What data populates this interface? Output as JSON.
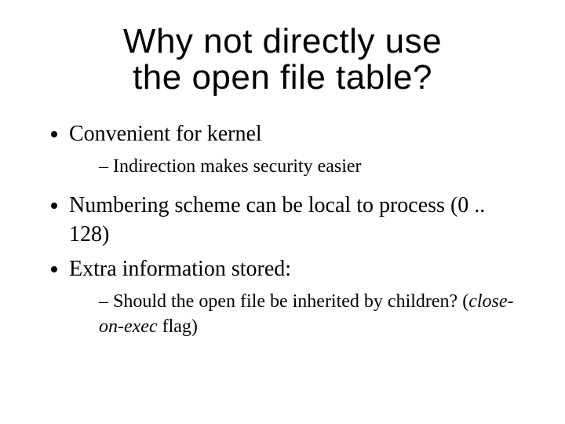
{
  "title_line1": "Why not directly use",
  "title_line2": "the open file table?",
  "b1": "Convenient for kernel",
  "b1_sub1": "Indirection makes security easier",
  "b2": "Numbering scheme can be local to process (0 .. 128)",
  "b3": "Extra information stored:",
  "b3_sub1_prefix": "Should the open file be inherited by children? (",
  "b3_sub1_italic": "close-on-exec",
  "b3_sub1_suffix": " flag)"
}
